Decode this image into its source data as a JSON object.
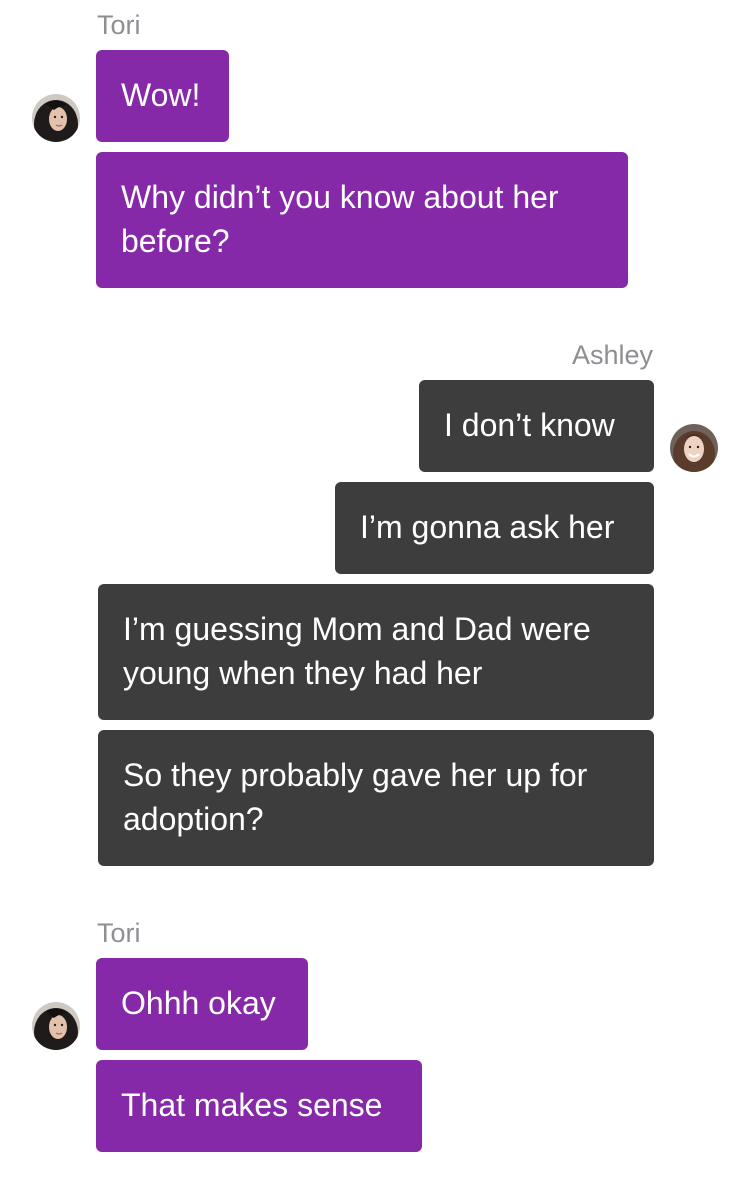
{
  "conversation": {
    "groups": [
      {
        "sender": "Tori",
        "messages": [
          "Wow!",
          "Why didn’t you know about her before?"
        ]
      },
      {
        "sender": "Ashley",
        "messages": [
          "I don’t know",
          "I’m gonna ask her",
          "I’m guessing Mom and Dad were young when they had her",
          "So they probably gave her up for adoption?"
        ]
      },
      {
        "sender": "Tori",
        "messages": [
          "Ohhh okay",
          "That makes sense"
        ]
      }
    ]
  },
  "colors": {
    "tori_bubble": "#8629a9",
    "ashley_bubble": "#3d3d3d",
    "sender_name": "#8e8e93"
  },
  "icons": {
    "tori_avatar": "tori-avatar-photo",
    "ashley_avatar": "ashley-avatar-photo"
  }
}
